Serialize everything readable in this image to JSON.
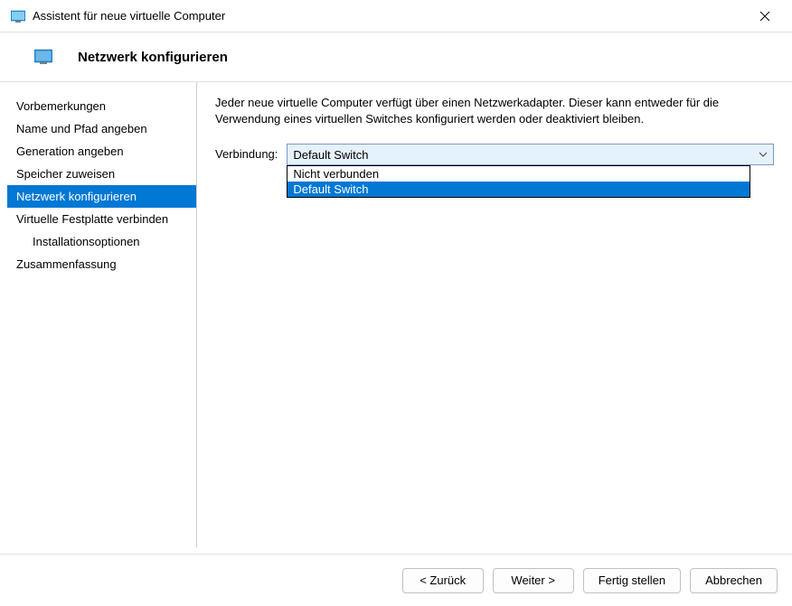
{
  "window": {
    "title": "Assistent für neue virtuelle Computer"
  },
  "header": {
    "title": "Netzwerk konfigurieren"
  },
  "sidebar": {
    "items": [
      {
        "label": "Vorbemerkungen",
        "selected": false,
        "indented": false
      },
      {
        "label": "Name und Pfad angeben",
        "selected": false,
        "indented": false
      },
      {
        "label": "Generation angeben",
        "selected": false,
        "indented": false
      },
      {
        "label": "Speicher zuweisen",
        "selected": false,
        "indented": false
      },
      {
        "label": "Netzwerk konfigurieren",
        "selected": true,
        "indented": false
      },
      {
        "label": "Virtuelle Festplatte verbinden",
        "selected": false,
        "indented": false
      },
      {
        "label": "Installationsoptionen",
        "selected": false,
        "indented": true
      },
      {
        "label": "Zusammenfassung",
        "selected": false,
        "indented": false
      }
    ]
  },
  "main": {
    "description": "Jeder neue virtuelle Computer verfügt über einen Netzwerkadapter. Dieser kann entweder für die Verwendung eines virtuellen Switches konfiguriert werden oder deaktiviert bleiben.",
    "connection_label": "Verbindung:",
    "dropdown": {
      "selected": "Default Switch",
      "options": [
        {
          "label": "Nicht verbunden",
          "highlighted": false
        },
        {
          "label": "Default Switch",
          "highlighted": true
        }
      ]
    }
  },
  "buttons": {
    "back": "< Zurück",
    "next": "Weiter >",
    "finish": "Fertig stellen",
    "cancel": "Abbrechen"
  }
}
